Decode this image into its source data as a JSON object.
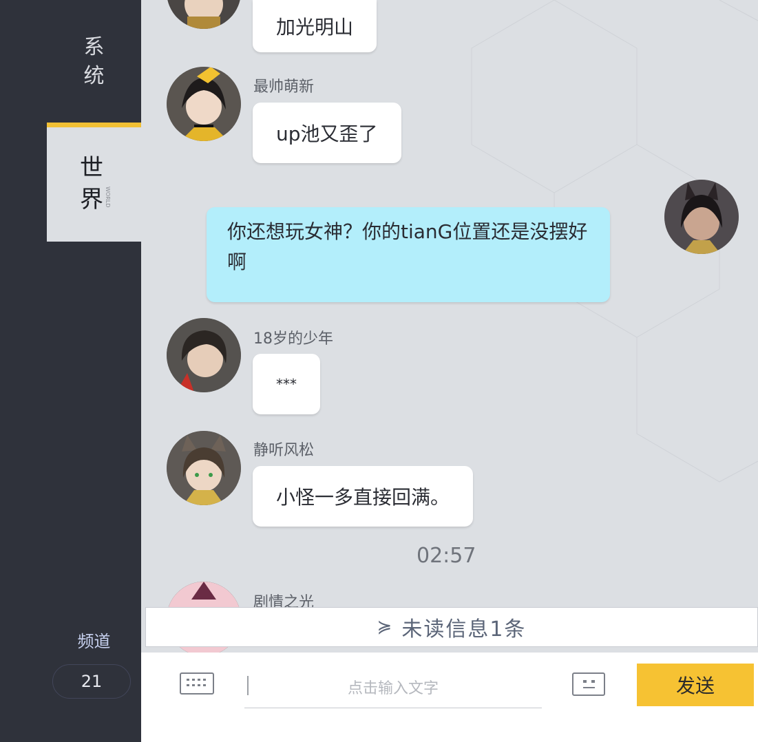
{
  "sidebar": {
    "tab_system": "系\n统",
    "tab_world": "世\n界",
    "tab_world_sub": "WORLD",
    "channel_label": "频道",
    "channel_count": "21"
  },
  "messages": [
    {
      "name": "",
      "text": "加光明山"
    },
    {
      "name": "最帅萌新",
      "text": "up池又歪了"
    },
    {
      "name": "",
      "text": "你还想玩女神？你的tianG位置还是没摆好啊",
      "mine": true
    },
    {
      "name": "18岁的少年",
      "text": "***"
    },
    {
      "name": "静听风松",
      "text": "小怪一多直接回满。"
    },
    {
      "name": "剧情之光",
      "text": ""
    }
  ],
  "time_divider": "02:57",
  "unread": {
    "chevron": "≽",
    "text": "未读信息1条"
  },
  "input": {
    "placeholder": "点击输入文字"
  },
  "send_label": "发送",
  "colors": {
    "accent": "#f1c034",
    "send": "#f6c233",
    "mine_bubble": "#b3eefb",
    "sidebar": "#2f323b"
  }
}
